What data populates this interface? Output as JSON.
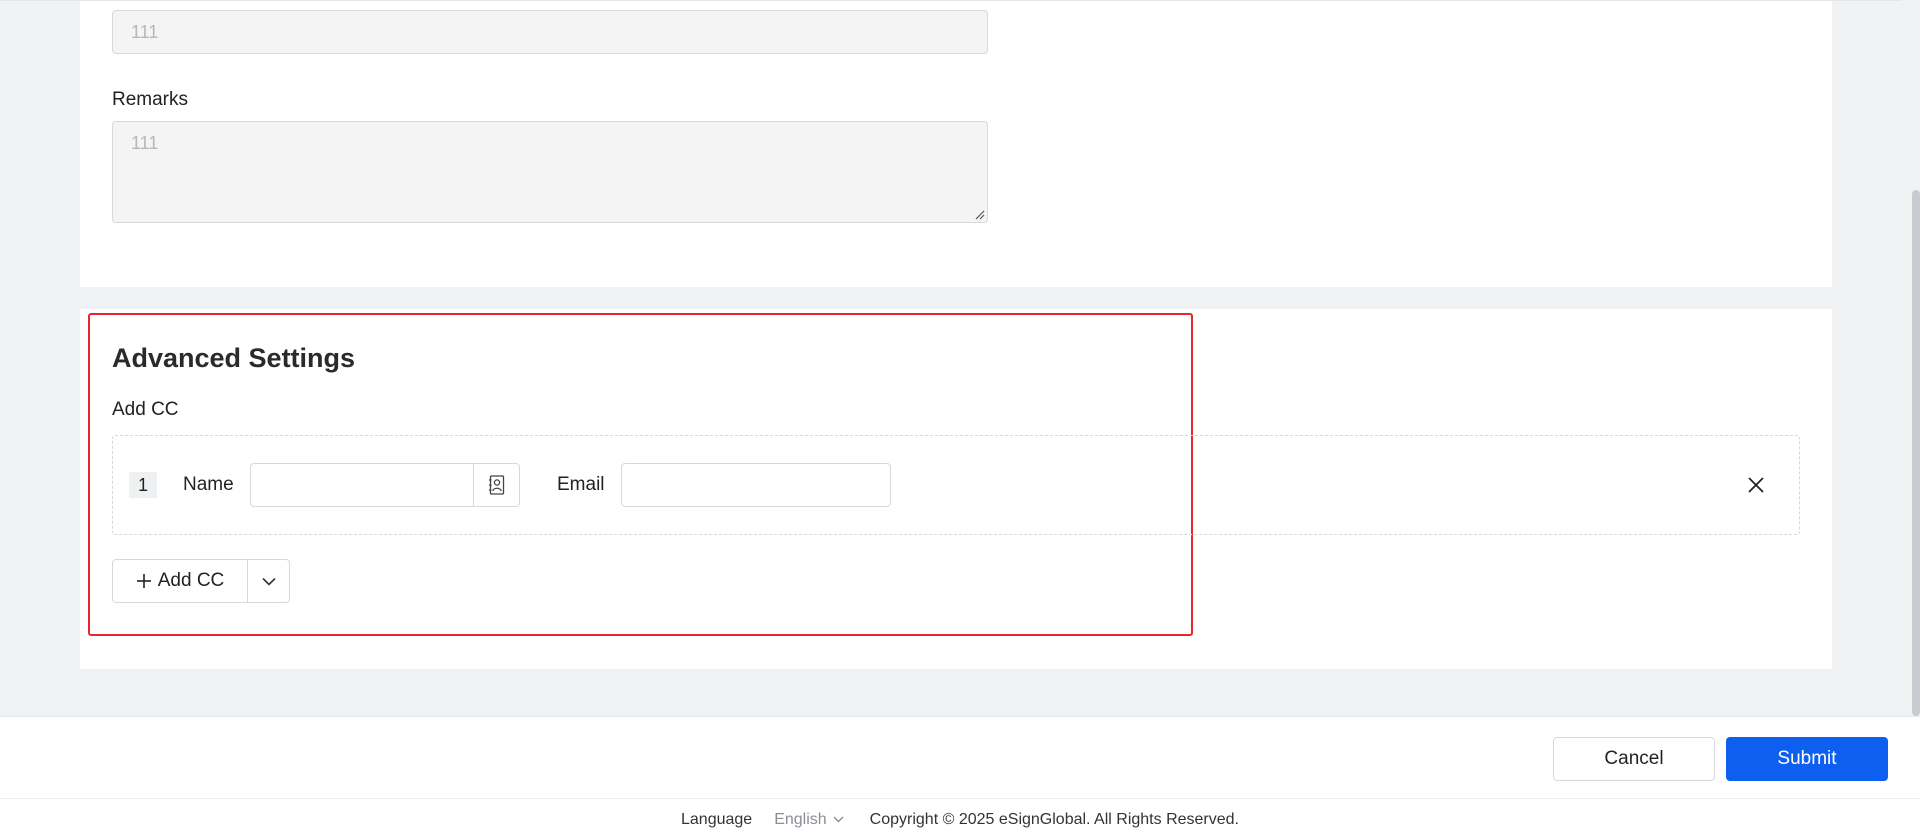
{
  "form": {
    "field_value": "111",
    "remarks_label": "Remarks",
    "remarks_value": "111"
  },
  "advanced": {
    "title": "Advanced Settings",
    "add_cc_label": "Add CC",
    "cc_rows": [
      {
        "index": "1",
        "name_label": "Name",
        "name_value": "",
        "email_label": "Email",
        "email_value": ""
      }
    ],
    "add_cc_button": "Add CC"
  },
  "actions": {
    "cancel": "Cancel",
    "submit": "Submit"
  },
  "footer": {
    "language_label": "Language",
    "language_value": "English",
    "copyright": "Copyright © 2025 eSignGlobal. All Rights Reserved."
  },
  "colors": {
    "primary": "#0e5ff0",
    "highlight": "#e8262b"
  },
  "icons": [
    "contacts-icon",
    "close-icon",
    "plus-icon",
    "chevron-down-icon",
    "resize-grip-icon"
  ]
}
